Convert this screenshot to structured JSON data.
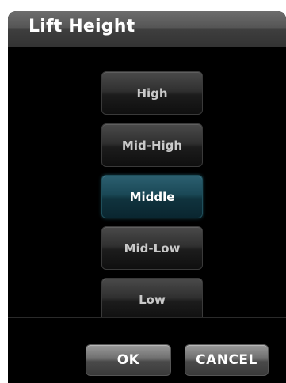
{
  "dialog": {
    "title": "Lift Height",
    "options": [
      {
        "label": "High",
        "selected": false
      },
      {
        "label": "Mid-High",
        "selected": false
      },
      {
        "label": "Middle",
        "selected": true
      },
      {
        "label": "Mid-Low",
        "selected": false
      },
      {
        "label": "Low",
        "selected": false
      }
    ],
    "ok_label": "OK",
    "cancel_label": "CANCEL"
  },
  "colors": {
    "background": "#000000",
    "selected_accent": "#1a4856",
    "button_text": "#ffffff"
  }
}
